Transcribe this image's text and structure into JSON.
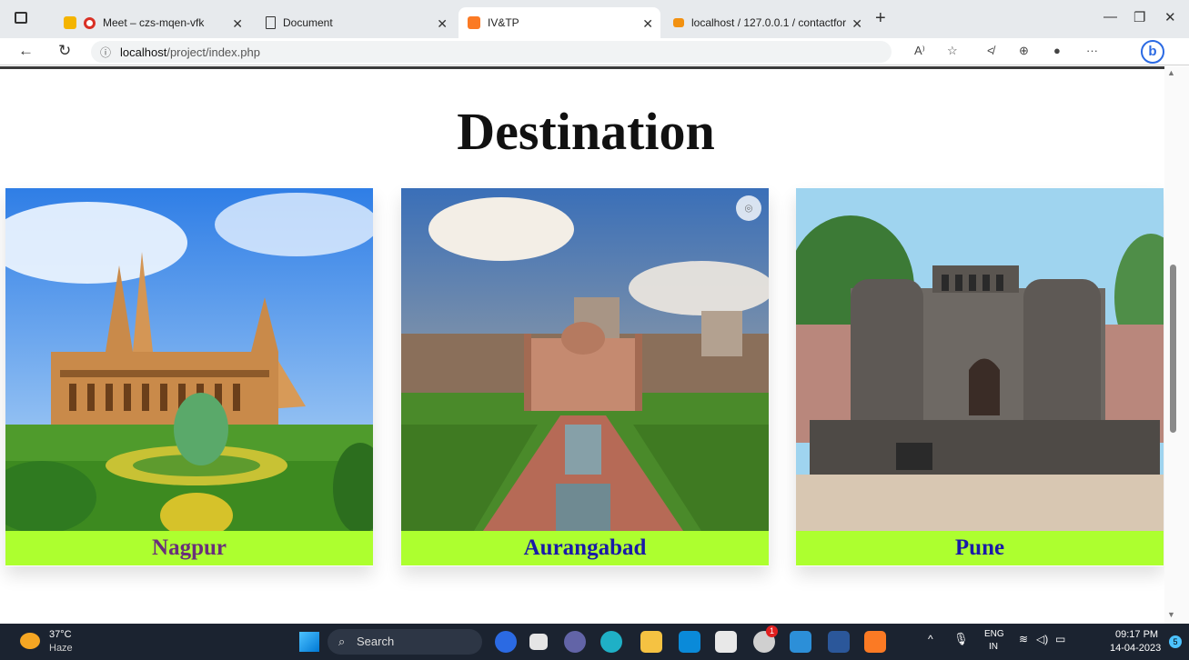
{
  "browser": {
    "tabs": [
      {
        "label": "Meet – czs-mqen-vfk"
      },
      {
        "label": "Document"
      },
      {
        "label": "IV&TP"
      },
      {
        "label": "localhost / 127.0.0.1 / contactfor"
      }
    ],
    "new_tab": "+",
    "url_host": "localhost",
    "url_path": "/project/index.php",
    "colors": {
      "accent": "#adff2f",
      "title_text": "#111111"
    }
  },
  "page": {
    "title": "Destination",
    "cards": [
      {
        "name": "Nagpur",
        "color": "#6a2f7a",
        "image": "temple-photo"
      },
      {
        "name": "Aurangabad",
        "color": "#1a1aa8",
        "image": "fort-garden-photo"
      },
      {
        "name": "Pune",
        "color": "#1a1aa8",
        "image": "shaniwar-wada-photo"
      }
    ]
  },
  "taskbar": {
    "temp": "37°C",
    "weather": "Haze",
    "search_label": "Search",
    "notification_count": "1",
    "lang_top": "ENG",
    "lang_bottom": "IN",
    "time": "09:17 PM",
    "date": "14-04-2023",
    "badge": "5"
  }
}
